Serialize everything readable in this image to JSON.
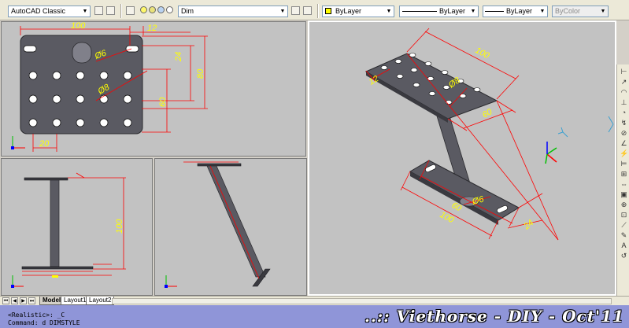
{
  "toolbar": {
    "workspace": "AutoCAD Classic",
    "layer": "Dim",
    "color": "ByLayer",
    "linetype": "ByLayer",
    "lineweight": "ByLayer",
    "plotstyle": "ByColor"
  },
  "colors": {
    "viewport_bg": "#c2c2c2",
    "dimension_line": "#ff0000",
    "dimension_text": "#ffff00",
    "model_fill": "#5a5a62",
    "command_bg": "#8f95d8"
  },
  "drawing": {
    "top_view": {
      "dim_length": "100",
      "dim_offset": "12",
      "dim_hole_small": "Ø6",
      "dim_hole_large": "Ø8",
      "dim_v1": "24",
      "dim_v2": "60",
      "dim_v3": "80",
      "dim_bottom": "20"
    },
    "front_view": {
      "dim_height": "100"
    },
    "iso_view": {
      "dim_top_long": "100",
      "dim_top_short": "12",
      "dim_top_hole": "Ø8",
      "dim_top_width": "60",
      "dim_base_long": "100",
      "dim_base_short": "60",
      "dim_base_hole": "Ø6",
      "dim_base_width": "24"
    }
  },
  "tabs": [
    "Model",
    "Layout1",
    "Layout2"
  ],
  "active_tab": "Model",
  "command": {
    "line1": "<Realistic>: _C",
    "line2": "Command: d DIMSTYLE"
  },
  "watermark": "..:: Viethorse - DIY - Oct'11"
}
